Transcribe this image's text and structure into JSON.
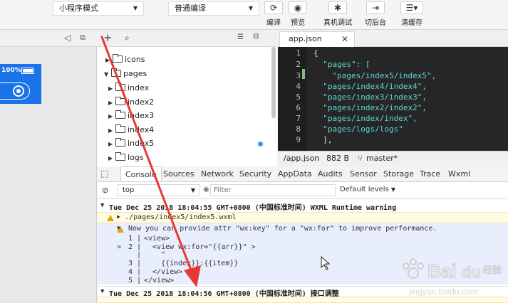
{
  "toolbar": {
    "mode_select": "小程序模式",
    "compile_select": "普通编译",
    "buttons": [
      {
        "label": "编译",
        "icon": "refresh-icon"
      },
      {
        "label": "预览",
        "icon": "eye-icon"
      },
      {
        "label": "真机调试",
        "icon": "debug-bug-icon"
      },
      {
        "label": "切后台",
        "icon": "background-switch-icon"
      },
      {
        "label": "清缓存",
        "icon": "layers-icon"
      }
    ]
  },
  "simulator": {
    "battery": "100%"
  },
  "tree": {
    "items": [
      {
        "label": "icons",
        "expanded": false
      },
      {
        "label": "pages",
        "expanded": true
      },
      {
        "label": "index",
        "expanded": false
      },
      {
        "label": "index2",
        "expanded": false
      },
      {
        "label": "index3",
        "expanded": false
      },
      {
        "label": "index4",
        "expanded": false
      },
      {
        "label": "index5",
        "expanded": false
      },
      {
        "label": "logs",
        "expanded": false
      }
    ]
  },
  "editor": {
    "tab_name": "app.json",
    "line_numbers": [
      "1",
      "2",
      "3",
      "4",
      "5",
      "6",
      "7",
      "8",
      "9"
    ],
    "lines": [
      "{",
      "  \"pages\": [",
      "    \"pages/index5/index5\",",
      "  \"pages/index4/index4\",",
      "  \"pages/index3/index3\",",
      "  \"pages/index2/index2\",",
      "  \"pages/index/index\",",
      "  \"pages/logs/logs\"",
      "  ],"
    ],
    "status_path": "/app.json",
    "status_size": "882 B",
    "status_branch": "master*"
  },
  "devtools": {
    "tabs": [
      "Console",
      "Sources",
      "Network",
      "Security",
      "AppData",
      "Audits",
      "Sensor",
      "Storage",
      "Trace",
      "Wxml"
    ],
    "context": "top",
    "filter_placeholder": "Filter",
    "levels": "Default levels"
  },
  "console": {
    "group1_header": "Tue Dec 25 2018 18:04:55 GMT+0800 (中国标准时间) WXML Runtime warning",
    "group1_file": "./pages/index5/index5.wxml",
    "warning_text": "Now you can provide attr \"wx:key\" for a \"wx:for\" to improve performance.",
    "code_lines": [
      {
        "marker": "",
        "num": "1",
        "text": "<view>"
      },
      {
        "marker": ">",
        "num": "2",
        "text": "  <view wx:for=\"{{arr}}\" >"
      },
      {
        "marker": "",
        "num": "",
        "text": "    ^"
      },
      {
        "marker": "",
        "num": "3",
        "text": "    {{index}}:{{item}}"
      },
      {
        "marker": "",
        "num": "4",
        "text": "  </view>"
      },
      {
        "marker": "",
        "num": "5",
        "text": "</view>"
      }
    ],
    "group2_header": "Tue Dec 25 2018 18:04:56 GMT+0800 (中国标准时间) 接口调整"
  },
  "watermark": {
    "logo": "Baidu经验",
    "url": "jingyan.baidu.com"
  }
}
